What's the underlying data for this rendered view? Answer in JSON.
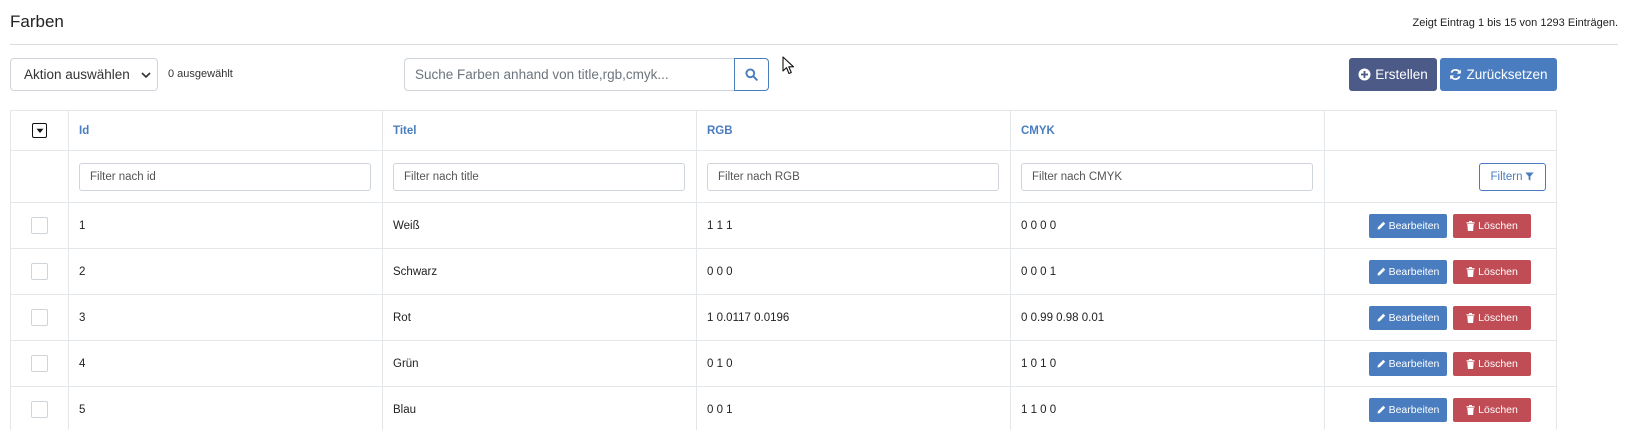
{
  "page": {
    "title": "Farben",
    "entries_info": "Zeigt Eintrag 1 bis 15 von 1293 Einträgen."
  },
  "toolbar": {
    "action_select_value": "Aktion auswählen",
    "selected_count": "0 ausgewählt",
    "search_placeholder": "Suche Farben anhand von title,rgb,cmyk...",
    "create_label": "Erstellen",
    "reset_label": "Zurücksetzen"
  },
  "table": {
    "columns": [
      "Id",
      "Titel",
      "RGB",
      "CMYK"
    ],
    "filters": {
      "id_placeholder": "Filter nach id",
      "title_placeholder": "Filter nach title",
      "rgb_placeholder": "Filter nach RGB",
      "cmyk_placeholder": "Filter nach CMYK",
      "filter_button": "Filtern"
    },
    "edit_label": "Bearbeiten",
    "delete_label": "Löschen",
    "rows": [
      {
        "id": "1",
        "title": "Weiß",
        "rgb": "1 1 1",
        "cmyk": "0 0 0 0"
      },
      {
        "id": "2",
        "title": "Schwarz",
        "rgb": "0 0 0",
        "cmyk": "0 0 0 1"
      },
      {
        "id": "3",
        "title": "Rot",
        "rgb": "1 0.0117 0.0196",
        "cmyk": "0 0.99 0.98 0.01"
      },
      {
        "id": "4",
        "title": "Grün",
        "rgb": "0 1 0",
        "cmyk": "1 0 1 0"
      },
      {
        "id": "5",
        "title": "Blau",
        "rgb": "0 0 1",
        "cmyk": "1 1 0 0"
      }
    ]
  },
  "colors": {
    "primary": "#4a7dbf",
    "create_button": "#4b5a86",
    "danger": "#c04d55",
    "border": "#e4e7ea"
  },
  "icons": {
    "select_caret": "chevron-down-icon",
    "search": "search-icon",
    "create": "plus-circle-icon",
    "reset": "refresh-icon",
    "filter": "filter-icon",
    "edit": "pencil-icon",
    "delete": "trash-icon",
    "head_checkbox": "caret-down-icon",
    "cursor": "mouse-cursor-icon"
  }
}
